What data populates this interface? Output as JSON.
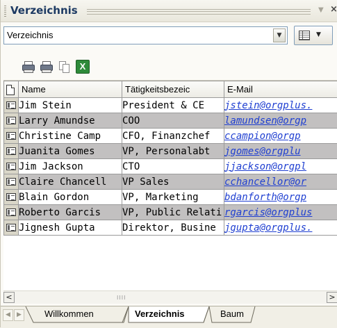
{
  "panel": {
    "title": "Verzeichnis"
  },
  "combo": {
    "value": "Verzeichnis"
  },
  "toolbar": {
    "excel_label": "X"
  },
  "table": {
    "headers": [
      "",
      "Name",
      "Tätigkeitsbezeic",
      "E-Mail"
    ],
    "rows": [
      {
        "name": "Jim Stein",
        "title": "President & CE",
        "email": "jstein@orgplus."
      },
      {
        "name": "Larry Amundse",
        "title": "COO",
        "email": "lamundsen@orgp"
      },
      {
        "name": "Christine Camp",
        "title": "CFO, Finanzchef",
        "email": "ccampion@orgp"
      },
      {
        "name": "Juanita Gomes",
        "title": "VP, Personalabt",
        "email": "jgomes@orgplu"
      },
      {
        "name": "Jim Jackson",
        "title": "CTO",
        "email": "jjackson@orgpl"
      },
      {
        "name": "Claire Chancell",
        "title": "VP Sales",
        "email": "cchancellor@or"
      },
      {
        "name": "Blain Gordon",
        "title": "VP, Marketing",
        "email": "bdanforth@orgp"
      },
      {
        "name": "Roberto Garcis",
        "title": "VP, Public Relati",
        "email": "rgarcis@orgplus"
      },
      {
        "name": "Jignesh Gupta",
        "title": "Direktor, Busine",
        "email": "jgupta@orgplus."
      }
    ]
  },
  "scroll": {
    "grip": "IIII"
  },
  "tabs": [
    {
      "label": "Willkommen"
    },
    {
      "label": "Verzeichnis"
    },
    {
      "label": "Baum"
    }
  ],
  "colors": {
    "title": "#1d3a63",
    "link": "#1f3fd1",
    "alt_row": "#c2c0c0"
  }
}
